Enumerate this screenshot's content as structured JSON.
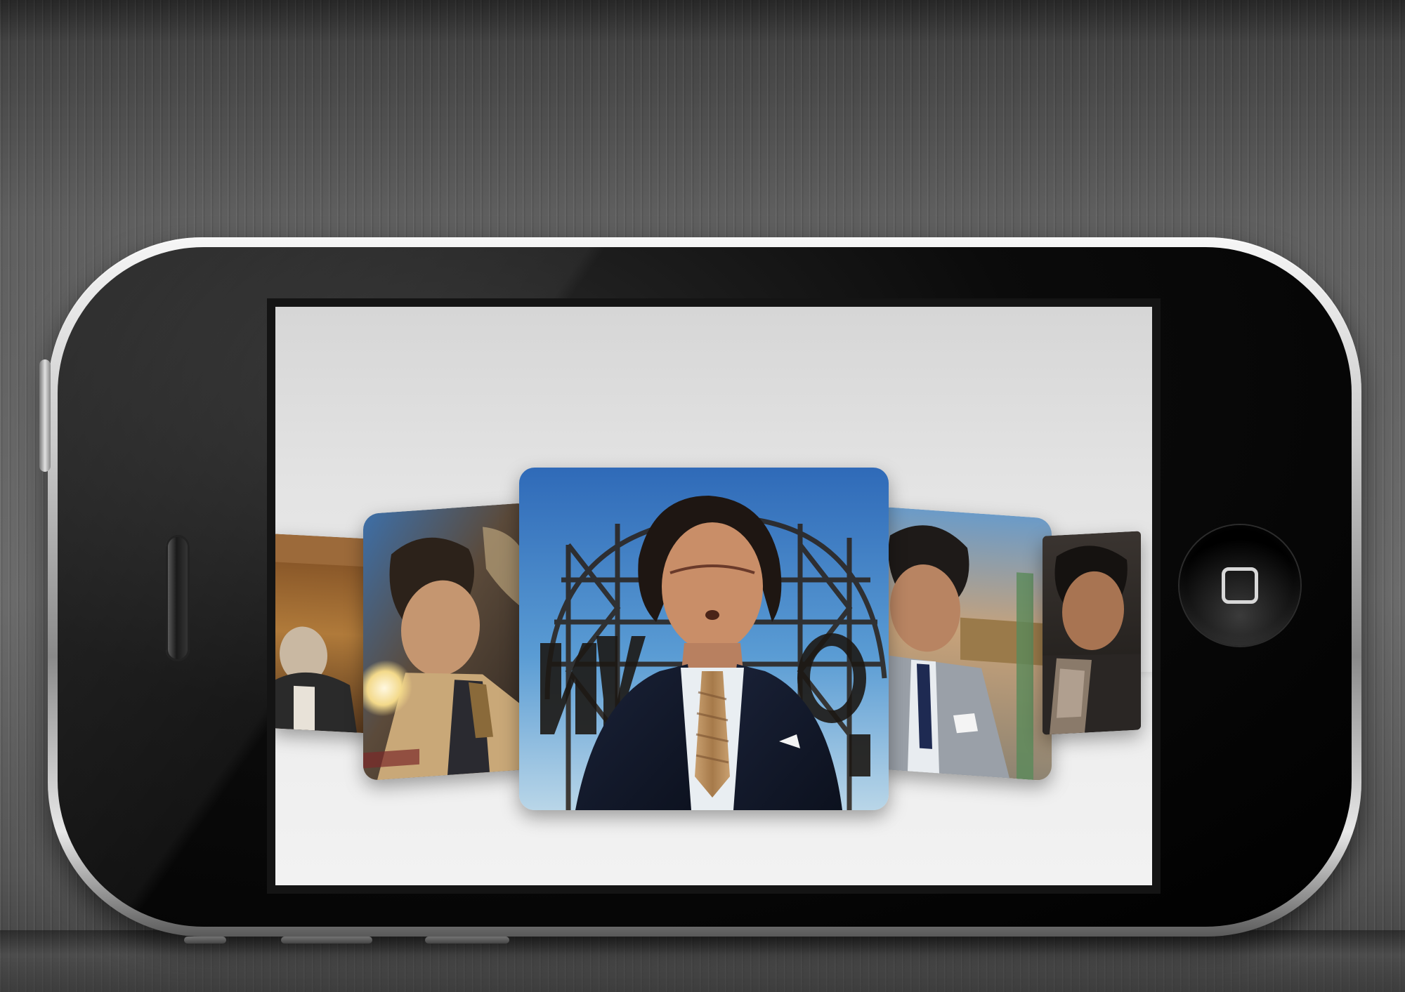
{
  "device": {
    "name": "phone",
    "screen_content": "cover-flow"
  },
  "cover_flow": {
    "covers": [
      {
        "position": "far-left",
        "icon": "album-cover"
      },
      {
        "position": "left",
        "icon": "album-cover"
      },
      {
        "position": "center",
        "icon": "album-cover",
        "selected": true
      },
      {
        "position": "right",
        "icon": "album-cover"
      },
      {
        "position": "far-right",
        "icon": "album-cover"
      }
    ]
  },
  "colors": {
    "background": "#5f5f5f",
    "bezel": "#000000",
    "screen": "#e6e6e6",
    "sky": "#3f7cc4"
  }
}
